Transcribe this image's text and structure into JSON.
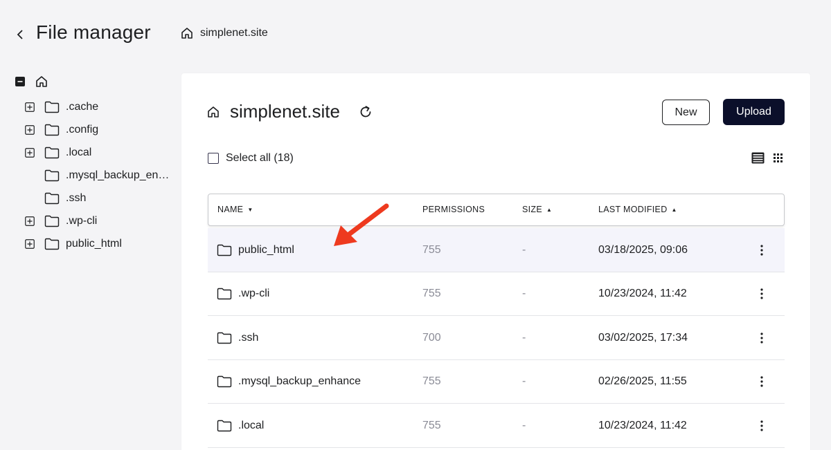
{
  "header": {
    "back_icon": "chevron-left-icon",
    "title": "File manager",
    "breadcrumb_icon": "home-icon",
    "breadcrumb_label": "simplenet.site"
  },
  "sidebar": {
    "root_icon": "home-icon",
    "items": [
      {
        "label": ".cache",
        "expandable": true
      },
      {
        "label": ".config",
        "expandable": true
      },
      {
        "label": ".local",
        "expandable": true
      },
      {
        "label": ".mysql_backup_enh...",
        "expandable": false
      },
      {
        "label": ".ssh",
        "expandable": false
      },
      {
        "label": ".wp-cli",
        "expandable": true
      },
      {
        "label": "public_html",
        "expandable": true
      }
    ]
  },
  "main": {
    "title": "simplenet.site",
    "new_label": "New",
    "upload_label": "Upload",
    "select_all_label": "Select all (18)",
    "columns": {
      "name": "NAME",
      "permissions": "PERMISSIONS",
      "size": "SIZE",
      "last_modified": "LAST MODIFIED"
    },
    "rows": [
      {
        "name": "public_html",
        "permissions": "755",
        "size": "-",
        "modified": "03/18/2025, 09:06"
      },
      {
        "name": ".wp-cli",
        "permissions": "755",
        "size": "-",
        "modified": "10/23/2024, 11:42"
      },
      {
        "name": ".ssh",
        "permissions": "700",
        "size": "-",
        "modified": "03/02/2025, 17:34"
      },
      {
        "name": ".mysql_backup_enhance",
        "permissions": "755",
        "size": "-",
        "modified": "02/26/2025, 11:55"
      },
      {
        "name": ".local",
        "permissions": "755",
        "size": "-",
        "modified": "10/23/2024, 11:42"
      }
    ]
  },
  "colors": {
    "accent_dark": "#0b0f2a",
    "highlight_row": "#f4f4fb",
    "annotation_arrow": "#ee3a1f"
  }
}
